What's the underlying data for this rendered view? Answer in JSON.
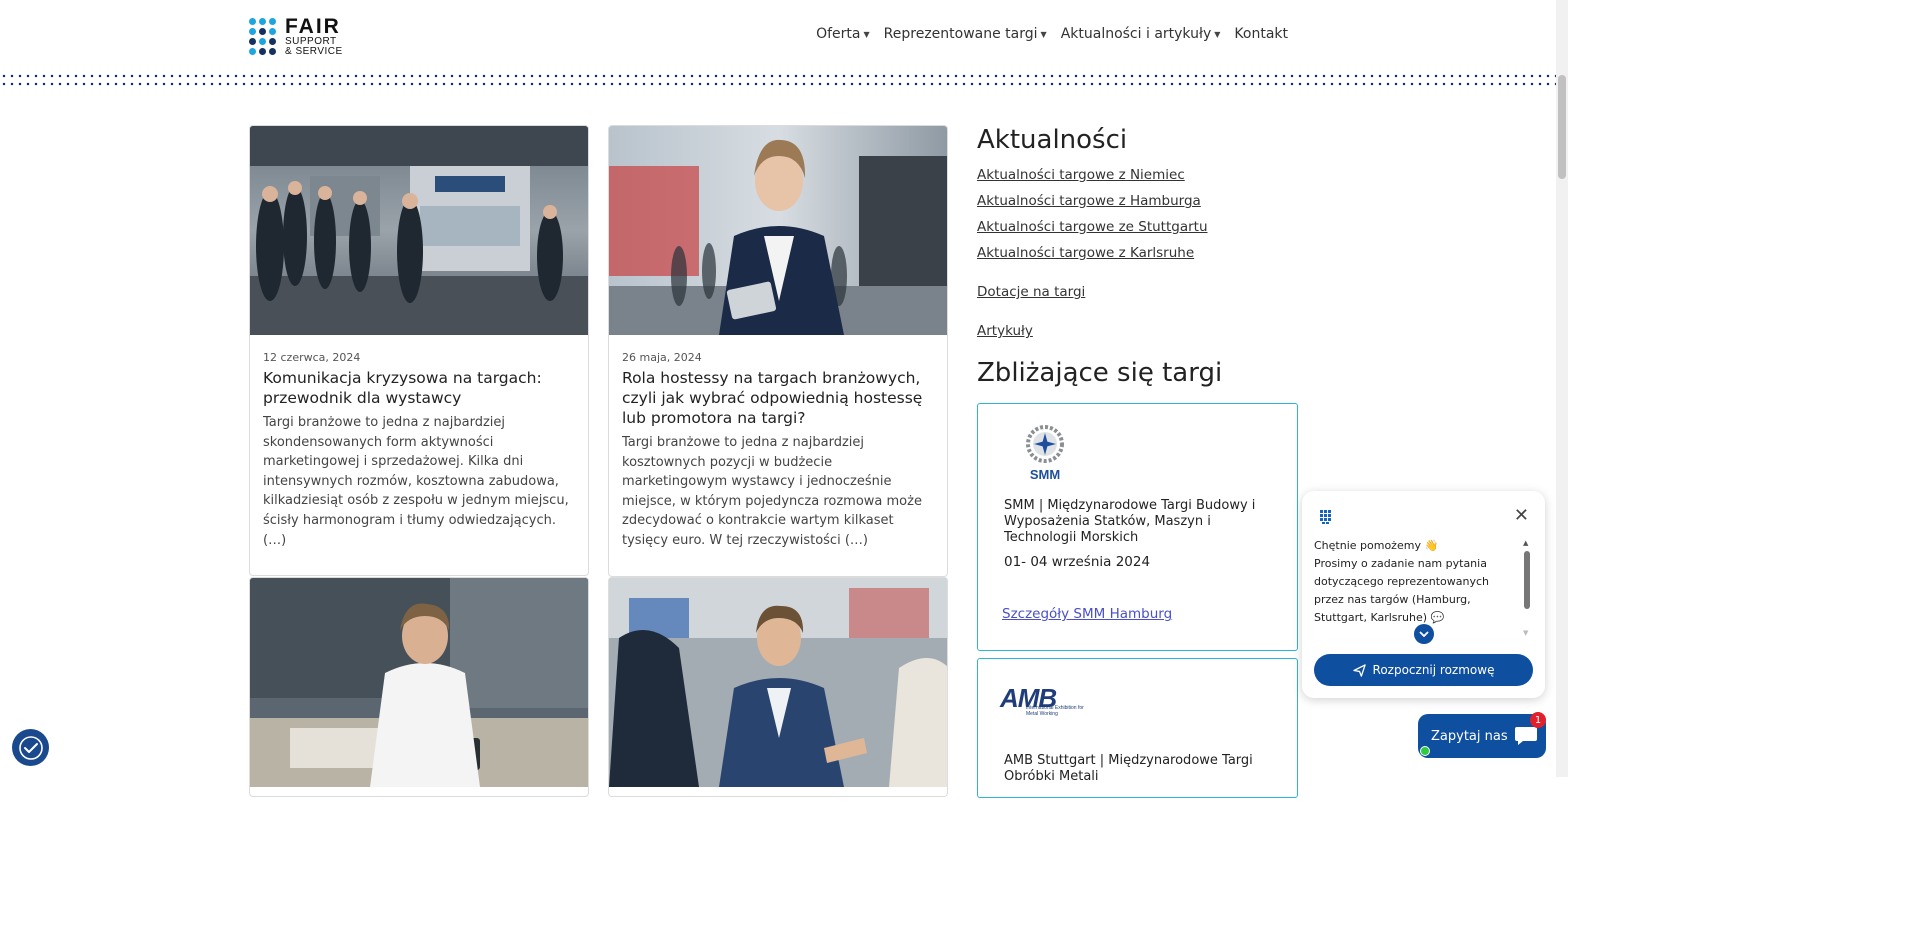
{
  "header": {
    "logo": {
      "big": "FAIR",
      "line2": "SUPPORT",
      "line3": "& SERVICE"
    },
    "nav": [
      {
        "label": "Oferta",
        "dropdown": true
      },
      {
        "label": "Reprezentowane targi",
        "dropdown": true
      },
      {
        "label": "Aktualności i artykuły",
        "dropdown": true
      },
      {
        "label": "Kontakt",
        "dropdown": false
      }
    ]
  },
  "articles": [
    {
      "date": "12 czerwca, 2024",
      "title": "Komunikacja kryzysowa na targach: przewodnik dla wystawcy",
      "excerpt": "Targi branżowe to jedna z najbardziej skondensowanych form aktywności marketingowej i sprzedażowej. Kilka dni intensywnych rozmów, kosztowna zabudowa, kilkadziesiąt osób z zespołu w jednym miejscu, ścisły harmonogram i tłumy odwiedzających. (…)",
      "image": "trade-fair-booth-crowd-photo"
    },
    {
      "date": "26 maja, 2024",
      "title": "Rola hostessy na targach branżowych, czyli jak wybrać odpowiednią hostessę lub promotora na targi?",
      "excerpt": "Targi branżowe to jedna z najbardziej kosztownych pozycji w budżecie marketingowym wystawcy i jednocześnie miejsce, w którym pojedyncza rozmowa może zdecydować o kontrakcie wartym kilkaset tysięcy euro. W tej rzeczywistości (…)",
      "image": "hostess-with-tablet-photo"
    },
    {
      "image": "man-studying-plans-photo"
    },
    {
      "image": "handshake-at-fair-photo"
    }
  ],
  "sidebar": {
    "news_heading": "Aktualności",
    "news_links": [
      "Aktualności targowe z Niemiec",
      "Aktualności targowe z Hamburga",
      "Aktualności targowe ze Stuttgartu",
      "Aktualności targowe z Karlsruhe"
    ],
    "grants_link": "Dotacje na targi",
    "articles_link": "Artykuły",
    "upcoming_heading": "Zbliżające się targi",
    "fairs": [
      {
        "logo_text": "SMM",
        "name": "SMM | Międzynarodowe Targi Budowy i Wyposażenia Statków, Maszyn i Technologii Morskich",
        "date": "01- 04 września 2024",
        "link": "Szczegóły SMM Hamburg"
      },
      {
        "logo_text": "AMB",
        "logo_sub": "International Exhibition for Metal Working",
        "name": "AMB Stuttgart | Międzynarodowe Targi Obróbki Metali"
      }
    ]
  },
  "chat": {
    "greeting": "Chętnie pomożemy 👋",
    "message": "Prosimy o zadanie nam pytania dotyczącego reprezentowanych przez nas targów (Hamburg, Stuttgart, Karlsruhe) 💬",
    "start_button": "Rozpocznij rozmowę",
    "ask_button": "Zapytaj nas",
    "badge_count": "1"
  },
  "colors": {
    "brand_blue": "#0f4fa0",
    "accent_teal": "#2fb5d2",
    "link_purple": "#4a4fc8",
    "dots_navy": "#14315f"
  }
}
